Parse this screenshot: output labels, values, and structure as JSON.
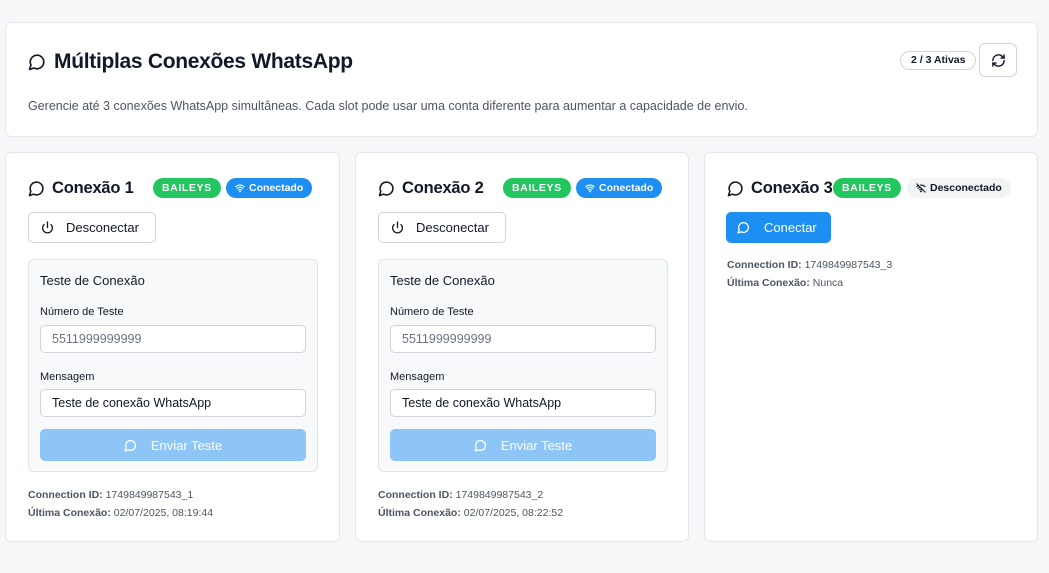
{
  "header": {
    "title": "Múltiplas Conexões WhatsApp",
    "description": "Gerencie até 3 conexões WhatsApp simultâneas. Cada slot pode usar uma conta diferente para aumentar a capacidade de envio.",
    "active_badge": "2 / 3 Ativas"
  },
  "colors": {
    "baileys_badge": "#22c55e",
    "connected_badge": "#1d8ef2",
    "primary_button": "#1d8ef2",
    "disabled_button": "#8ec5f7"
  },
  "icons": {
    "title": "message-circle-icon",
    "refresh": "refresh-icon",
    "connected": "wifi-icon",
    "disconnected": "wifi-off-icon",
    "disconnect": "power-icon"
  },
  "connections": [
    {
      "title": "Conexão 1",
      "provider": "BAILEYS",
      "status": "Conectado",
      "action": "Desconectar",
      "test": {
        "title": "Teste de Conexão",
        "number_label": "Número de Teste",
        "number_placeholder": "5511999999999",
        "message_label": "Mensagem",
        "message_value": "Teste de conexão WhatsApp",
        "send_label": "Enviar Teste"
      },
      "id_label": "Connection ID:",
      "id_value": "1749849987543_1",
      "last_label": "Última Conexão:",
      "last_value": "02/07/2025, 08:19:44"
    },
    {
      "title": "Conexão 2",
      "provider": "BAILEYS",
      "status": "Conectado",
      "action": "Desconectar",
      "test": {
        "title": "Teste de Conexão",
        "number_label": "Número de Teste",
        "number_placeholder": "5511999999999",
        "message_label": "Mensagem",
        "message_value": "Teste de conexão WhatsApp",
        "send_label": "Enviar Teste"
      },
      "id_label": "Connection ID:",
      "id_value": "1749849987543_2",
      "last_label": "Última Conexão:",
      "last_value": "02/07/2025, 08:22:52"
    },
    {
      "title": "Conexão 3",
      "provider": "BAILEYS",
      "status": "Desconectado",
      "action": "Conectar",
      "id_label": "Connection ID:",
      "id_value": "1749849987543_3",
      "last_label": "Última Conexão:",
      "last_value": "Nunca"
    }
  ]
}
